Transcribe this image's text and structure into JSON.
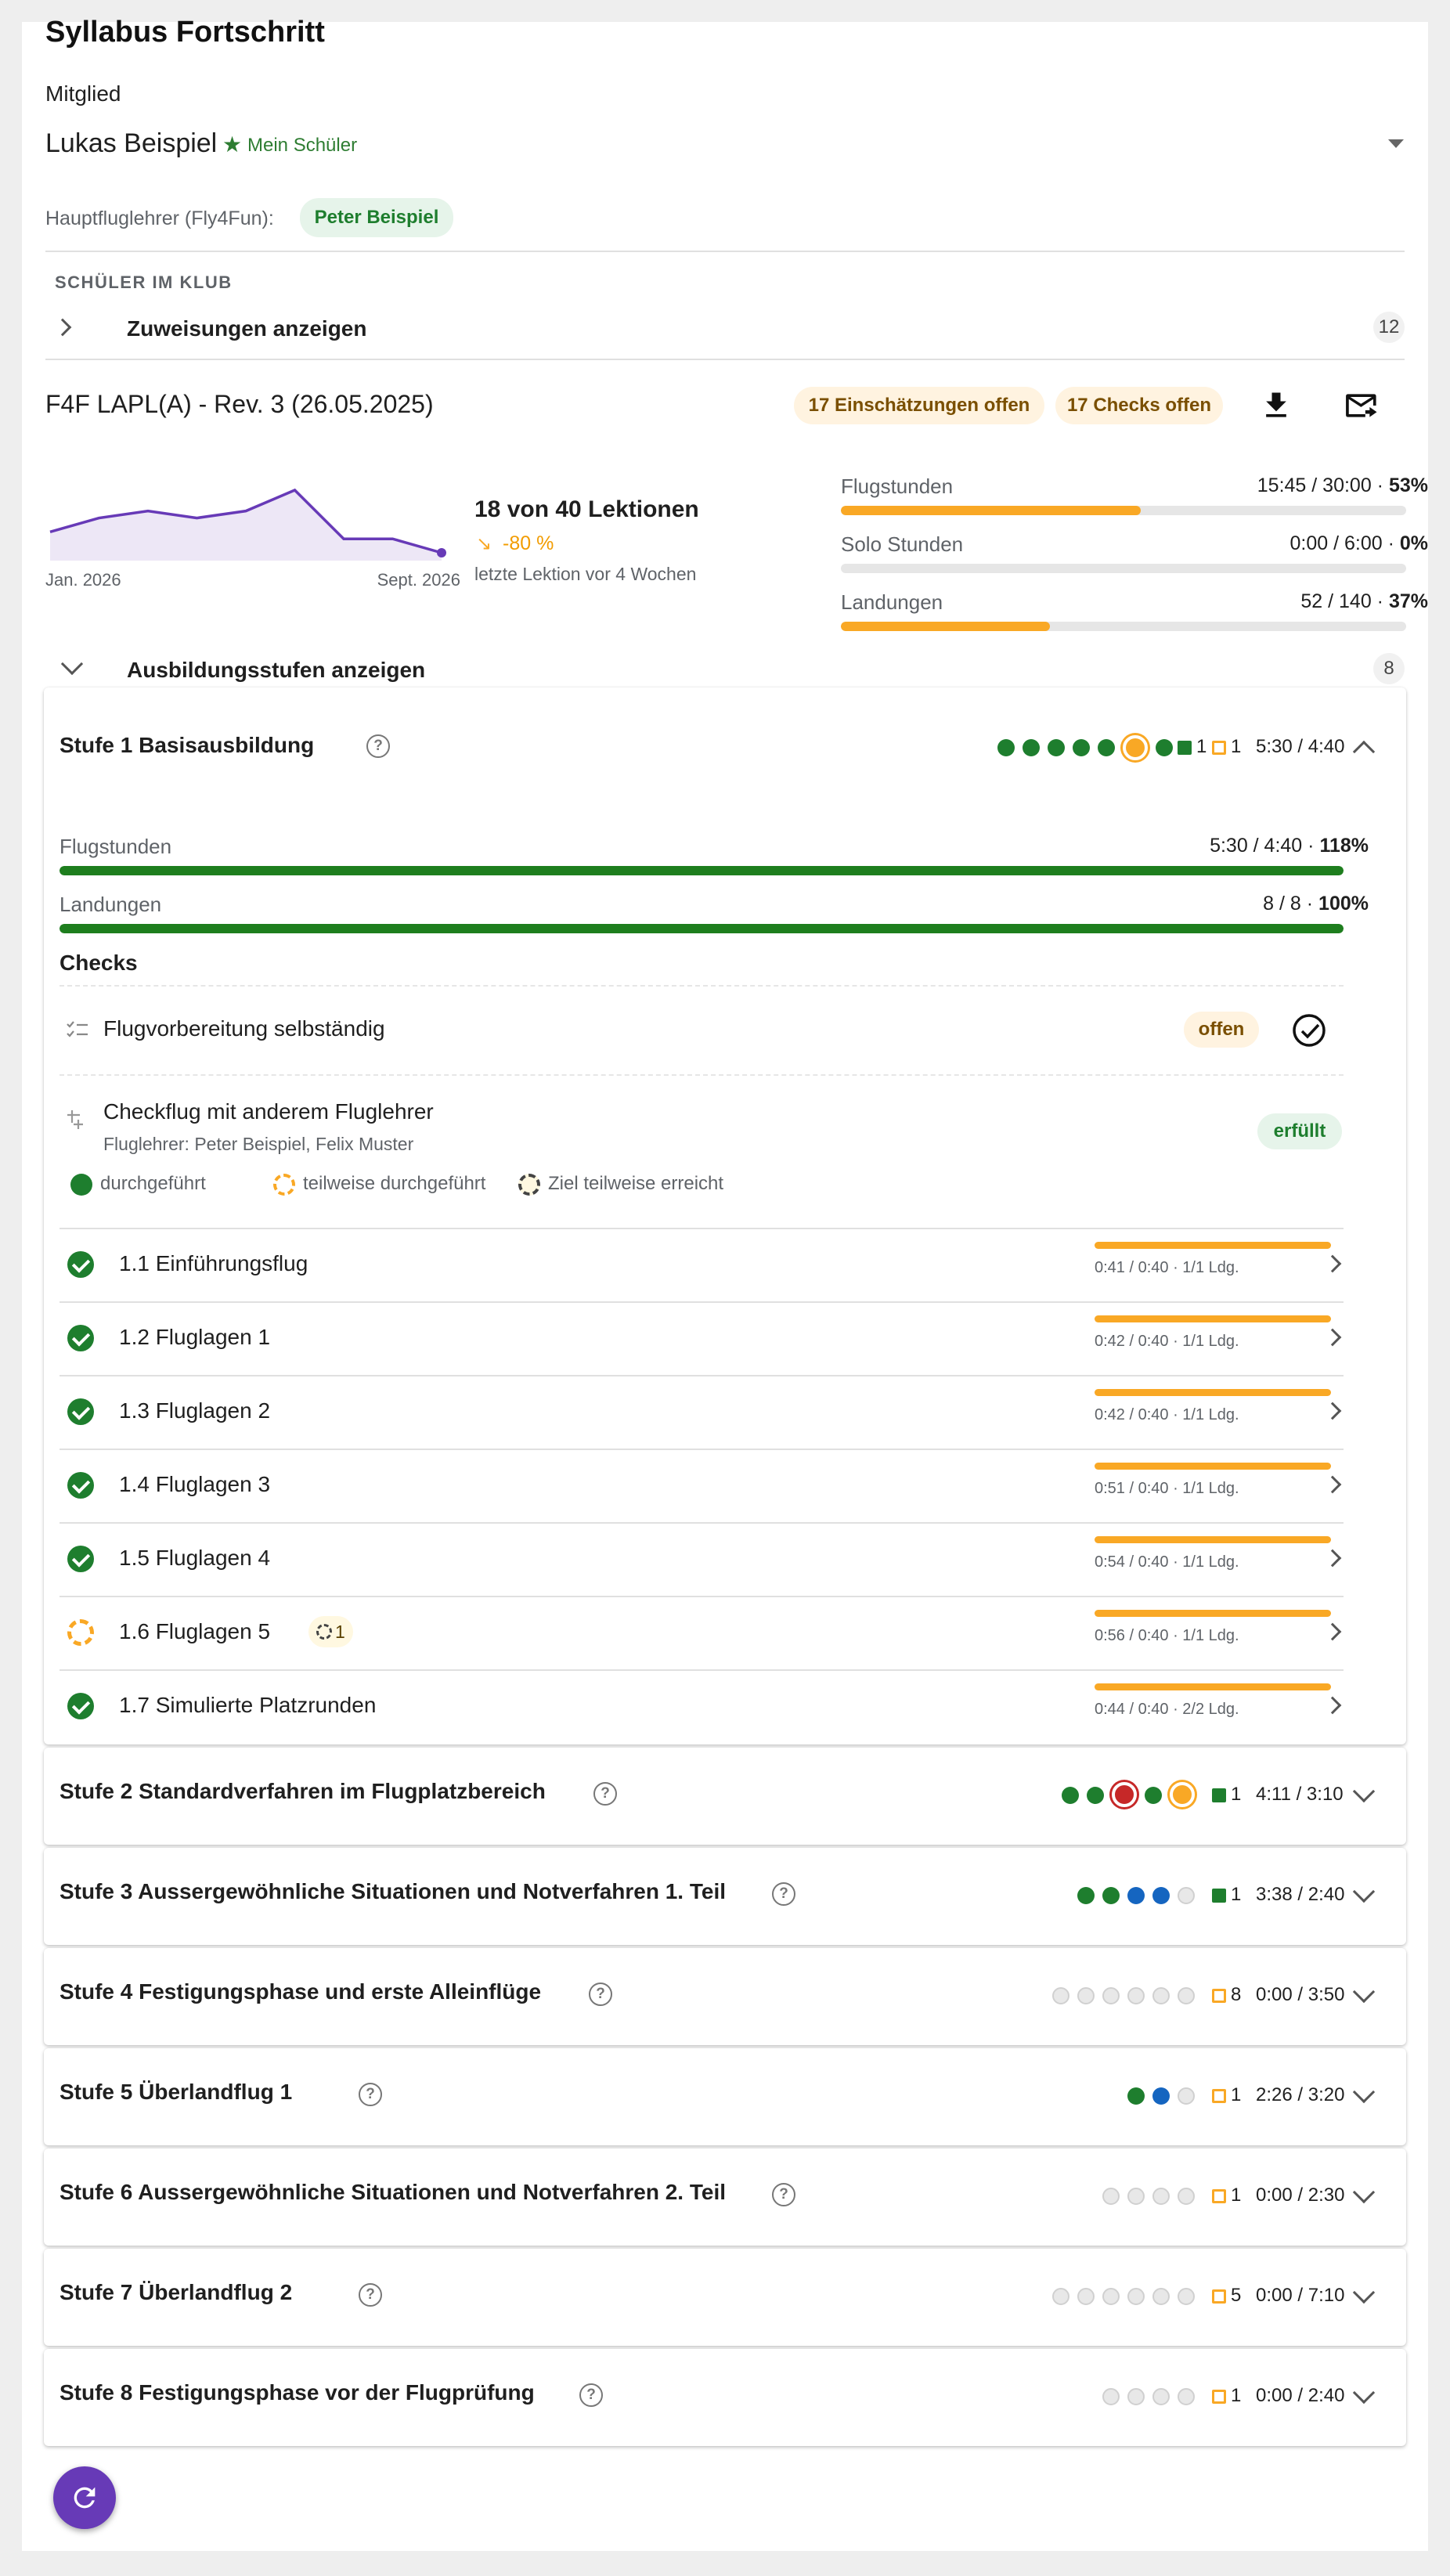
{
  "title": "Syllabus Fortschritt",
  "member": {
    "label": "Mitglied",
    "name": "Lukas Beispiel",
    "badge": "Mein Schüler"
  },
  "instructor": {
    "label": "Hauptfluglehrer (Fly4Fun):",
    "name": "Peter Beispiel"
  },
  "club": {
    "section_label": "SCHÜLER IM KLUB",
    "toggle_label": "Zuweisungen anzeigen",
    "count": "12"
  },
  "syllabus": {
    "title": "F4F LAPL(A) - Rev. 3 (26.05.2025)",
    "assessments_chip": "17 Einschätzungen offen",
    "checks_chip": "17 Checks offen",
    "sparkline": {
      "start_label": "Jan. 2026",
      "end_label": "Sept. 2026",
      "values": [
        3,
        5,
        6,
        5,
        6,
        9,
        2,
        2,
        0
      ]
    },
    "lessons": "18 von 40 Lektionen",
    "trend": "-80 %",
    "last_lesson": "letzte Lektion vor 4 Wochen",
    "metrics": [
      {
        "label": "Flugstunden",
        "value": "15:45 / 30:00 · ",
        "percent": "53%",
        "fill": 0.53
      },
      {
        "label": "Solo Stunden",
        "value": "0:00 / 6:00 · ",
        "percent": "0%",
        "fill": 0
      },
      {
        "label": "Landungen",
        "value": "52 / 140 · ",
        "percent": "37%",
        "fill": 0.37
      }
    ]
  },
  "stages_toggle": {
    "label": "Ausbildungsstufen anzeigen",
    "count": "8"
  },
  "stage1": {
    "title": "Stufe 1 Basisausbildung",
    "sq_green_count": "1",
    "sq_orange_count": "1",
    "hours": "5:30 / 4:40",
    "metrics": [
      {
        "label": "Flugstunden",
        "value": "5:30 / 4:40 · ",
        "percent": "118%",
        "fill": 1.0
      },
      {
        "label": "Landungen",
        "value": "8 / 8 · ",
        "percent": "100%",
        "fill": 1.0
      }
    ],
    "checks_title": "Checks",
    "checks": [
      {
        "name": "Flugvorbereitung selbständig",
        "status": "offen"
      },
      {
        "name": "Checkflug mit anderem Fluglehrer",
        "sub": "Fluglehrer: Peter Beispiel, Felix Muster",
        "status": "erfüllt"
      }
    ],
    "legend": [
      "durchgeführt",
      "teilweise durchgeführt",
      "Ziel teilweise erreicht"
    ],
    "lessons": [
      {
        "name": "1.1 Einführungsflug",
        "stats": "0:41 / 0:40 · 1/1 Ldg.",
        "state": "done"
      },
      {
        "name": "1.2 Fluglagen 1",
        "stats": "0:42 / 0:40 · 1/1 Ldg.",
        "state": "done"
      },
      {
        "name": "1.3 Fluglagen 2",
        "stats": "0:42 / 0:40 · 1/1 Ldg.",
        "state": "done"
      },
      {
        "name": "1.4 Fluglagen 3",
        "stats": "0:51 / 0:40 · 1/1 Ldg.",
        "state": "done"
      },
      {
        "name": "1.5 Fluglagen 4",
        "stats": "0:54 / 0:40 · 1/1 Ldg.",
        "state": "done"
      },
      {
        "name": "1.6 Fluglagen 5",
        "stats": "0:56 / 0:40 · 1/1 Ldg.",
        "state": "partial",
        "badge": "1"
      },
      {
        "name": "1.7 Simulierte Platzrunden",
        "stats": "0:44 / 0:40 · 2/2 Ldg.",
        "state": "done"
      }
    ]
  },
  "stages": [
    {
      "title": "Stufe 2 Standardverfahren im Flugplatzbereich",
      "count": "1",
      "hours": "4:11 / 3:10"
    },
    {
      "title": "Stufe 3 Aussergewöhnliche Situationen und Notverfahren 1. Teil",
      "count": "1",
      "hours": "3:38 / 2:40"
    },
    {
      "title": "Stufe 4 Festigungsphase und erste Alleinflüge",
      "count": "8",
      "hours": "0:00 / 3:50"
    },
    {
      "title": "Stufe 5 Überlandflug 1",
      "count": "1",
      "hours": "2:26 / 3:20"
    },
    {
      "title": "Stufe 6 Aussergewöhnliche Situationen und Notverfahren 2. Teil",
      "count": "1",
      "hours": "0:00 / 2:30"
    },
    {
      "title": "Stufe 7 Überlandflug 2",
      "count": "5",
      "hours": "0:00 / 7:10"
    },
    {
      "title": "Stufe 8 Festigungsphase vor der Flugprüfung",
      "count": "1",
      "hours": "0:00 / 2:40"
    }
  ],
  "colors": {
    "accent": "#673ab7",
    "done_green": "#1e7e2e",
    "partial_orange": "#f9a825",
    "blue": "#1565c0",
    "red": "#c62828"
  }
}
